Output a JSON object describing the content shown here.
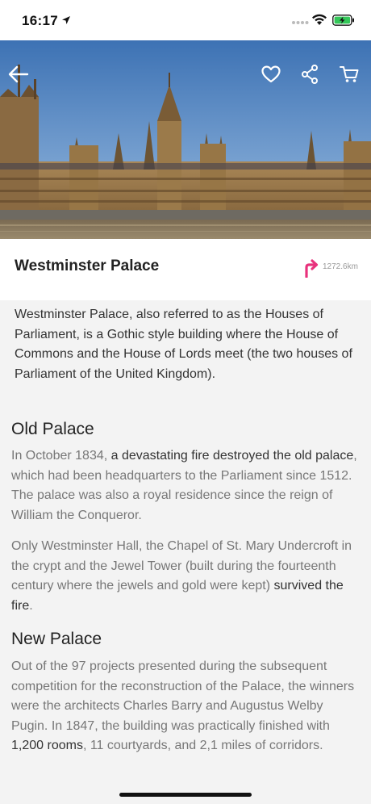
{
  "status_bar": {
    "time": "16:17"
  },
  "header": {
    "icons": [
      "back-arrow-icon",
      "heart-icon",
      "share-icon",
      "cart-icon"
    ]
  },
  "place": {
    "title": "Westminster Palace",
    "distance": "1272.6km",
    "accent_color": "#e8327c"
  },
  "intro": "Westminster Palace, also referred to as the Houses of Parliament, is a Gothic style building where the House of Commons and the House of Lords meet (the two houses of Parliament of the United Kingdom).",
  "old_palace": {
    "heading": "Old Palace",
    "p1_a": "In October 1834, ",
    "p1_b": "a devastating fire destroyed the old palace",
    "p1_c": ", which had been headquarters to the Parliament since 1512. The palace was also a royal residence since the reign of William the Conqueror.",
    "p2_a": "Only Westminster Hall, the Chapel of St. Mary Undercroft in the crypt and the Jewel Tower (built during the fourteenth century where the jewels and gold were kept) ",
    "p2_b": "survived the fire",
    "p2_c": "."
  },
  "new_palace": {
    "heading": "New Palace",
    "p_a": "Out of the 97 projects presented during the subsequent competition for the reconstruction of the Palace, the winners were the architects Charles Barry and Augustus Welby Pugin. In 1847, the building was practically finished with ",
    "p_b": "1,200 rooms",
    "p_c": ", 11 courtyards, and 2,1 miles of corridors."
  }
}
